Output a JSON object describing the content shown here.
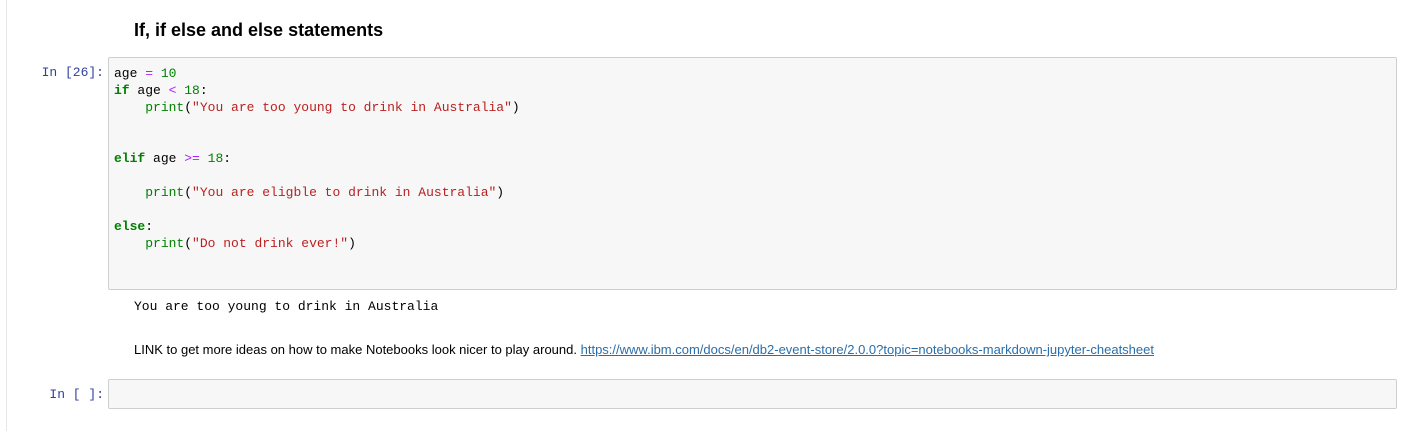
{
  "markdown_heading": "If, if else and else statements",
  "cells": [
    {
      "prompt": "In [26]:",
      "code": [
        [
          {
            "t": "age "
          },
          {
            "t": "=",
            "c": "op"
          },
          {
            "t": " "
          },
          {
            "t": "10",
            "c": "num"
          }
        ],
        [
          {
            "t": "if",
            "c": "kw"
          },
          {
            "t": " age "
          },
          {
            "t": "<",
            "c": "op"
          },
          {
            "t": " "
          },
          {
            "t": "18",
            "c": "num"
          },
          {
            "t": ":"
          }
        ],
        [
          {
            "t": "    "
          },
          {
            "t": "print",
            "c": "bi"
          },
          {
            "t": "("
          },
          {
            "t": "\"You are too young to drink in Australia\"",
            "c": "str"
          },
          {
            "t": ")"
          }
        ],
        [],
        [],
        [
          {
            "t": "elif",
            "c": "kw"
          },
          {
            "t": " age "
          },
          {
            "t": ">=",
            "c": "op"
          },
          {
            "t": " "
          },
          {
            "t": "18",
            "c": "num"
          },
          {
            "t": ":"
          }
        ],
        [],
        [
          {
            "t": "    "
          },
          {
            "t": "print",
            "c": "bi"
          },
          {
            "t": "("
          },
          {
            "t": "\"You are eligble to drink in Australia\"",
            "c": "str"
          },
          {
            "t": ")"
          }
        ],
        [],
        [
          {
            "t": "else",
            "c": "kw"
          },
          {
            "t": ":"
          }
        ],
        [
          {
            "t": "    "
          },
          {
            "t": "print",
            "c": "bi"
          },
          {
            "t": "("
          },
          {
            "t": "\"Do not drink ever!\"",
            "c": "str"
          },
          {
            "t": ")"
          }
        ]
      ],
      "output": "You are too young to drink in Australia"
    },
    {
      "prompt": "In [ ]:"
    }
  ],
  "markdown_link": {
    "text": "LINK to get more ideas on how to make Notebooks look nicer to play around.",
    "url": "https://www.ibm.com/docs/en/db2-event-store/2.0.0?topic=notebooks-markdown-jupyter-cheatsheet"
  },
  "colors": {
    "prompt": "#303f9f",
    "keyword": "#008000",
    "operator": "#aa22ff",
    "string": "#ba2121",
    "link": "#296eaa",
    "cell_background": "#f7f7f7",
    "cell_border": "#cfcfcf"
  }
}
